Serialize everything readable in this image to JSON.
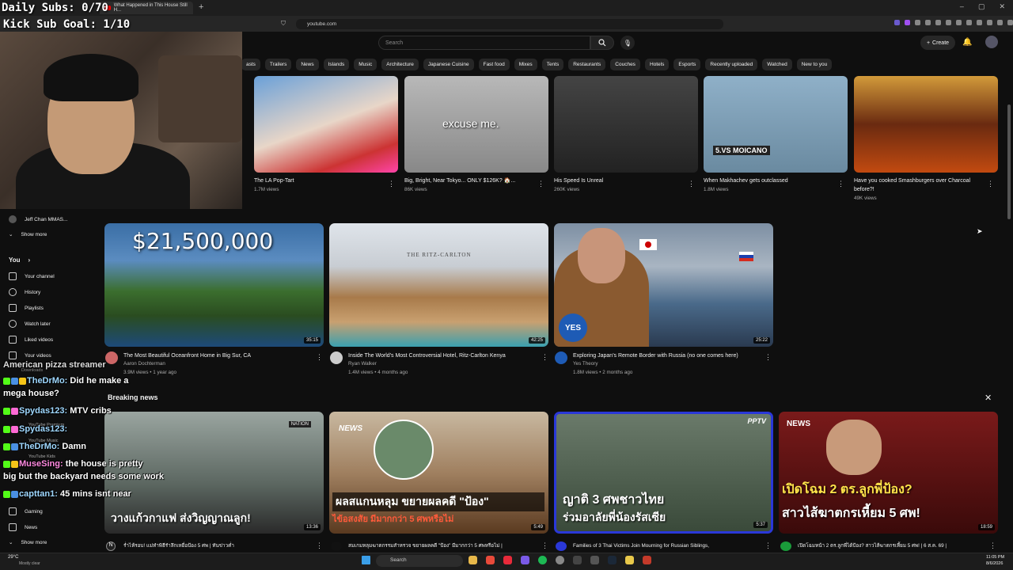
{
  "stream_overlay": {
    "daily_subs": "Daily Subs: 0/70",
    "kick_goal": "Kick Sub Goal: 1/10"
  },
  "browser": {
    "tab_title": "What Happened in This House Still H...",
    "url": "youtube.com"
  },
  "header": {
    "search_placeholder": "Search",
    "create_label": "Create"
  },
  "chips": [
    "asts",
    "Trailers",
    "News",
    "Islands",
    "Music",
    "Architecture",
    "Japanese Cuisine",
    "Fast food",
    "Mixes",
    "Tents",
    "Restaurants",
    "Couches",
    "Hotels",
    "Esports",
    "Recently uploaded",
    "Watched",
    "New to you"
  ],
  "top_videos": [
    {
      "title": "The LA Pop-Tart",
      "meta": "1.7M views"
    },
    {
      "title": "Big, Bright, Near Tokyo... ONLY $126K? 🏠...",
      "meta": "86K views",
      "overlay": "excuse me."
    },
    {
      "title": "His Speed Is Unreal",
      "meta": "260K views"
    },
    {
      "title": "When Makhachev gets outclassed",
      "meta": "1.8M views",
      "overlay": "5.VS MOICANO"
    },
    {
      "title": "Have you cooked Smashburgers over Charcoal before?!",
      "meta": "49K views"
    }
  ],
  "sidebar": {
    "subs_item": "Jeff Chan MMAS...",
    "show_more": "Show more",
    "you_label": "You",
    "items": [
      "Your channel",
      "History",
      "Playlists",
      "Watch later",
      "Liked videos",
      "Your videos",
      "Downloads"
    ],
    "explore_items": [
      "YouTube Premium",
      "YouTube Music",
      "YouTube Kids"
    ],
    "bottom_items": [
      "Gaming",
      "News",
      "Show more"
    ]
  },
  "mid_videos": [
    {
      "title": "The Most Beautiful Oceanfront Home in Big Sur, CA",
      "channel": "Aaron Dochterman",
      "meta": "3.9M views • 1 year ago",
      "duration": "35:15",
      "overlay": "$21,500,000"
    },
    {
      "title": "Inside The World's Most Controversial Hotel, Ritz-Carlton Kenya",
      "channel": "Ryan Walker",
      "meta": "1.4M views • 4 months ago",
      "duration": "42:25",
      "overlay": "THE RITZ-CARLTON"
    },
    {
      "title": "Exploring Japan's Remote Border with Russia (no one comes here)",
      "channel": "Yes Theory",
      "meta": "1.8M views • 2 months ago",
      "duration": "25:22",
      "overlay": "YES"
    }
  ],
  "breaking_news": {
    "label": "Breaking news",
    "videos": [
      {
        "title": "ร่ำไห้รอบ! แม่ทำพิธีรำลึกเหยื่อป้อง 5 ศพ | ทันข่าวค่ำ",
        "duration": "13:36",
        "caption": "วางแก้วกาแฟ ส่งวิญญาณลูก!",
        "badge": "NATION"
      },
      {
        "title": "สมเกมหลุมฆาตกรรมสำหรวจ ขยายผลคดี \"ป้อง\" มีมากกว่า 5 ศพหรือไม่ |",
        "duration": "5:49",
        "caption": "ผลสแกนหลุม ขยายผลคดี \"ป้อง\"",
        "caption2": "ไข้อสงสัย มีมากกว่า 5 ศพหรือไม่",
        "badge": "NEWS"
      },
      {
        "title": "Families of 3 Thai Victims Join Mourning for Russian Siblings,",
        "duration": "5:37",
        "caption": "ญาติ 3 ศพชาวไทย",
        "caption2": "ร่วมอาลัยพี่น้องรัสเซีย",
        "badge": "PPTV"
      },
      {
        "title": "เปิดโฉมหน้า 2 ตร.ลูกพี่ได้ป้อง? สาวไส้ฆาตกรเหี้ยม 5 ศพ! | 6 ส.ค. 69 |",
        "duration": "18:59",
        "caption": "เปิดโฉม 2 ตร.ลูกพี่ป้อง?",
        "caption2": "สาวไส้ฆาตกรเหี้ยม 5 ศพ!",
        "badge": "NEWS"
      }
    ]
  },
  "chat": [
    {
      "user": "",
      "text": "American pizza streamer"
    },
    {
      "user": "TheDrMo:",
      "text": "Did he make a"
    },
    {
      "user": "",
      "text": "mega house?"
    },
    {
      "user": "Spydas123:",
      "text": "MTV cribs"
    },
    {
      "user": "Spydas123:",
      "text": ""
    },
    {
      "user": "TheDrMo:",
      "text": "Damn"
    },
    {
      "user": "MuseSing:",
      "text": "the house is pretty"
    },
    {
      "user": "",
      "text": "big but the backyard needs some work"
    },
    {
      "user": "capttan1:",
      "text": "45 mins isnt near"
    }
  ],
  "taskbar": {
    "weather_temp": "29°C",
    "weather_desc": "Mostly clear",
    "search": "Search",
    "time": "11:05 PM",
    "date": "8/6/2026"
  }
}
